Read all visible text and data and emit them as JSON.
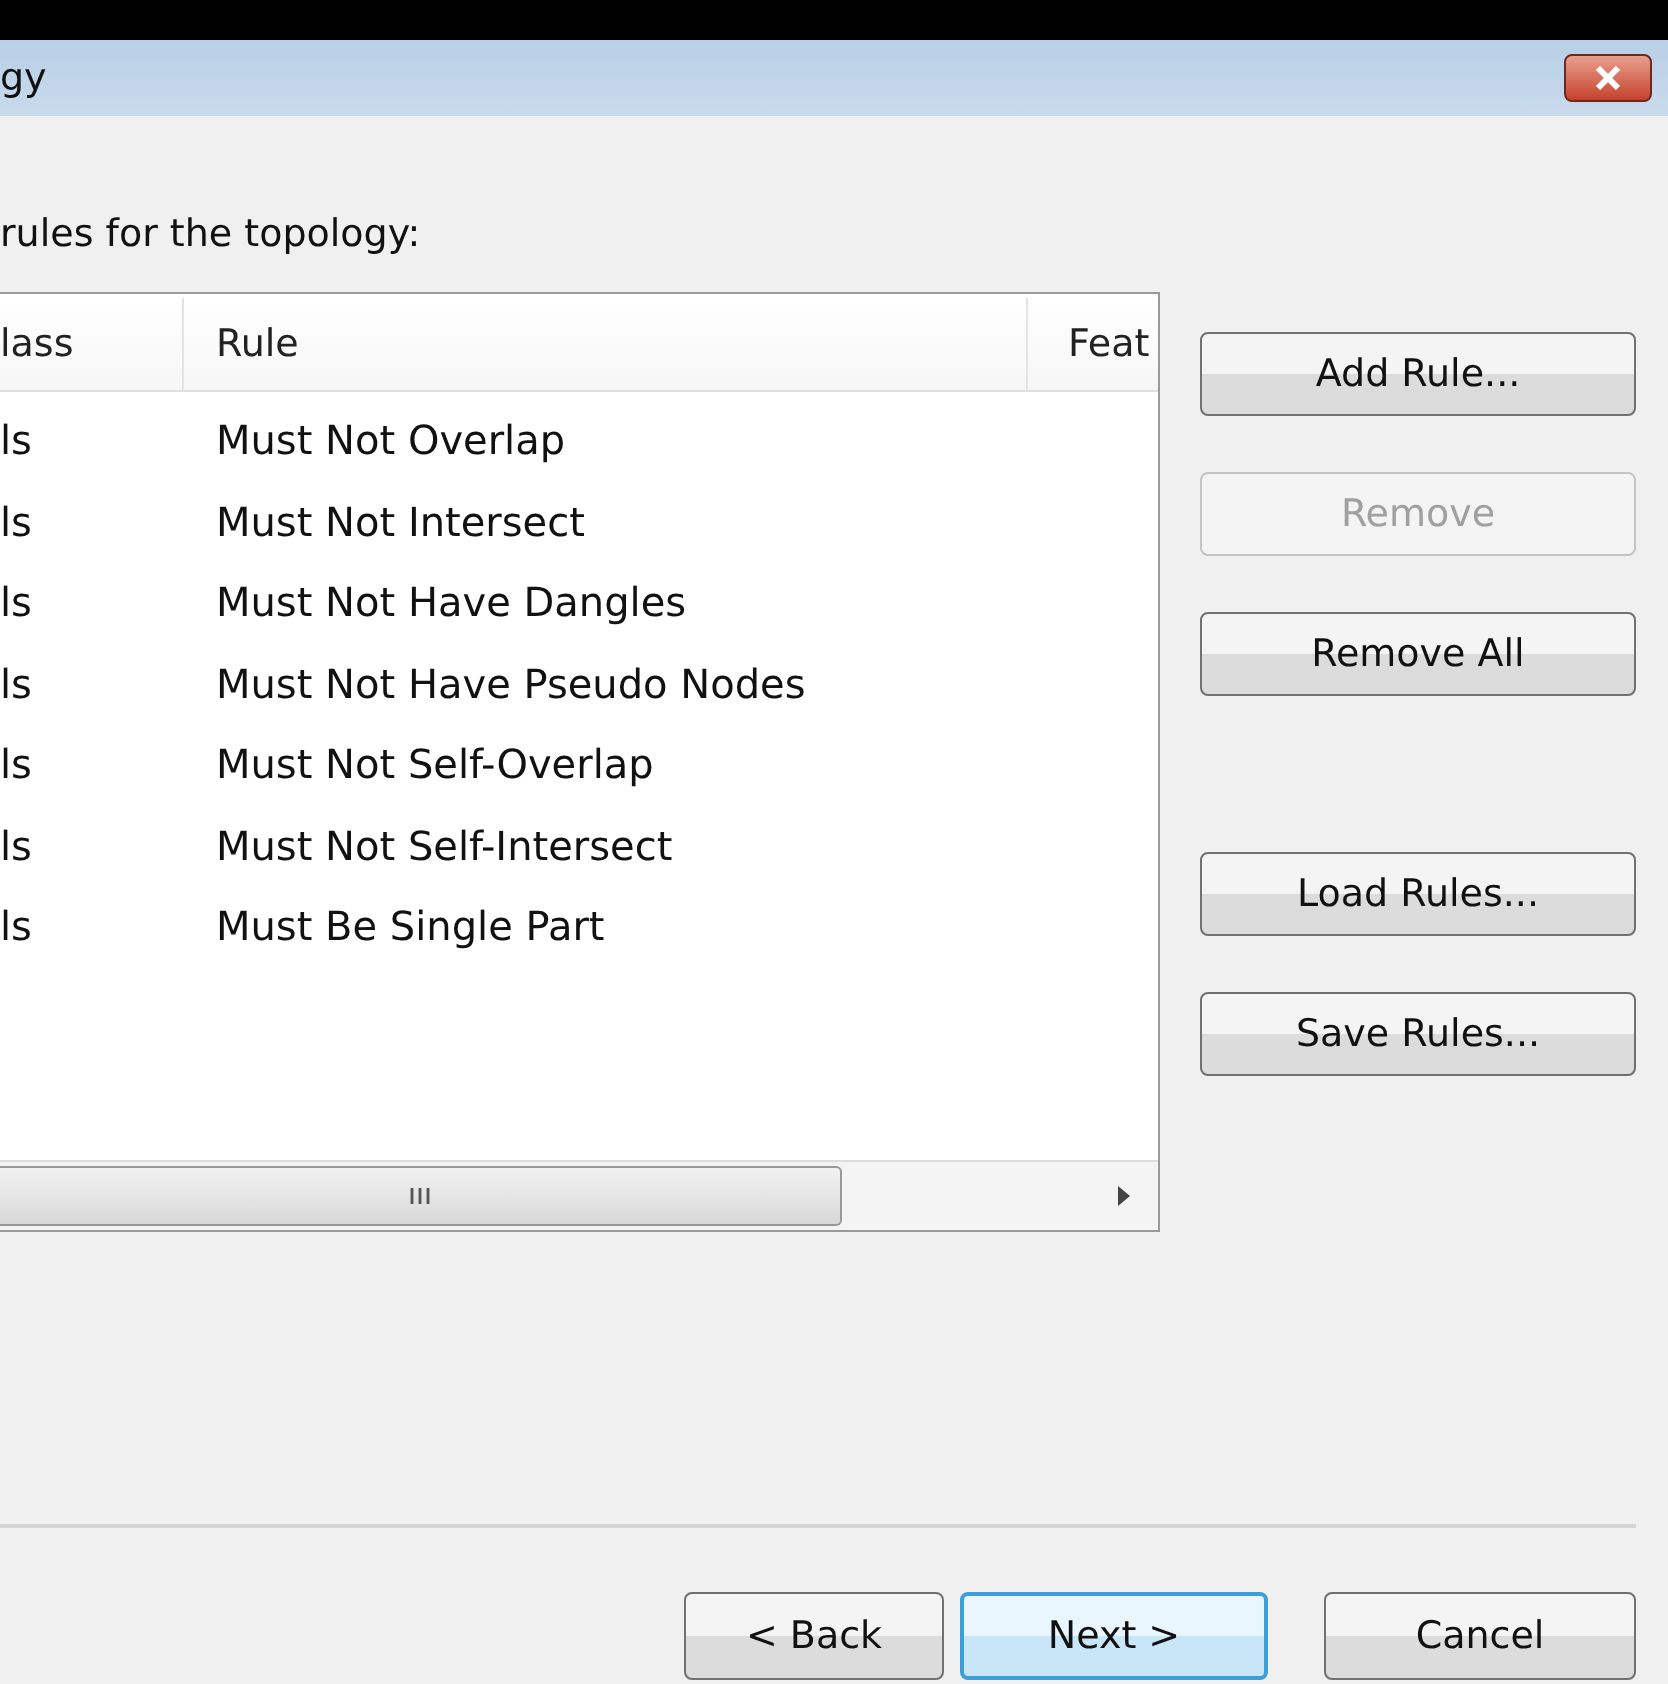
{
  "window": {
    "title": "gy"
  },
  "instruction": "rules for the topology:",
  "table": {
    "columns": [
      "lass",
      "Rule",
      "Feat"
    ],
    "rows": [
      {
        "column_1": "ls",
        "rule": "Must Not Overlap"
      },
      {
        "column_1": "ls",
        "rule": "Must Not Intersect"
      },
      {
        "column_1": "ls",
        "rule": "Must Not Have Dangles"
      },
      {
        "column_1": "ls",
        "rule": "Must Not Have Pseudo Nodes"
      },
      {
        "column_1": "ls",
        "rule": "Must Not Self-Overlap"
      },
      {
        "column_1": "ls",
        "rule": "Must Not Self-Intersect"
      },
      {
        "column_1": "ls",
        "rule": "Must Be Single Part"
      }
    ]
  },
  "side_button_groups": [
    [
      {
        "label": "Add Rule...",
        "disabled": false
      },
      {
        "label": "Remove",
        "disabled": true
      },
      {
        "label": "Remove All",
        "disabled": false
      }
    ],
    [
      {
        "label": "Load Rules...",
        "disabled": false
      },
      {
        "label": "Save Rules...",
        "disabled": false
      }
    ]
  ],
  "footer_buttons": [
    {
      "label": "< Back",
      "default": false
    },
    {
      "label": "Next >",
      "default": true
    },
    {
      "label": "Cancel",
      "default": false
    }
  ]
}
